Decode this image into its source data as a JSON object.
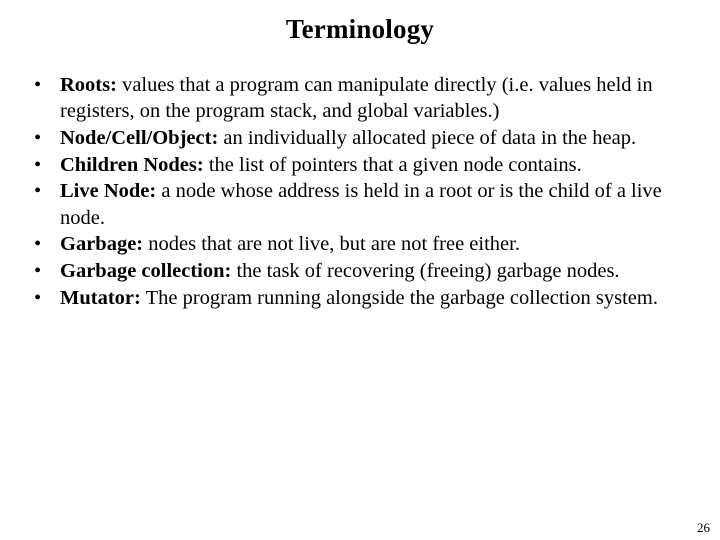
{
  "slide": {
    "title": "Terminology",
    "bullet_glyph": "•",
    "page_number": "26",
    "items": [
      {
        "term": "Roots:",
        "definition": " values that a program can manipulate directly (i.e. values held in registers, on the program stack, and global variables.)"
      },
      {
        "term": "Node/Cell/Object:",
        "definition": " an individually allocated piece of data in the heap."
      },
      {
        "term": "Children Nodes:",
        "definition": " the list of pointers that a given node contains."
      },
      {
        "term": "Live Node:",
        "definition": " a node whose address is held in a root or is the child of a live node."
      },
      {
        "term": "Garbage:",
        "definition": " nodes that are not live, but are not free either."
      },
      {
        "term": "Garbage collection:",
        "definition": " the task of recovering (freeing) garbage nodes."
      },
      {
        "term": "Mutator:",
        "definition": " The program running alongside the garbage collection system."
      }
    ]
  }
}
